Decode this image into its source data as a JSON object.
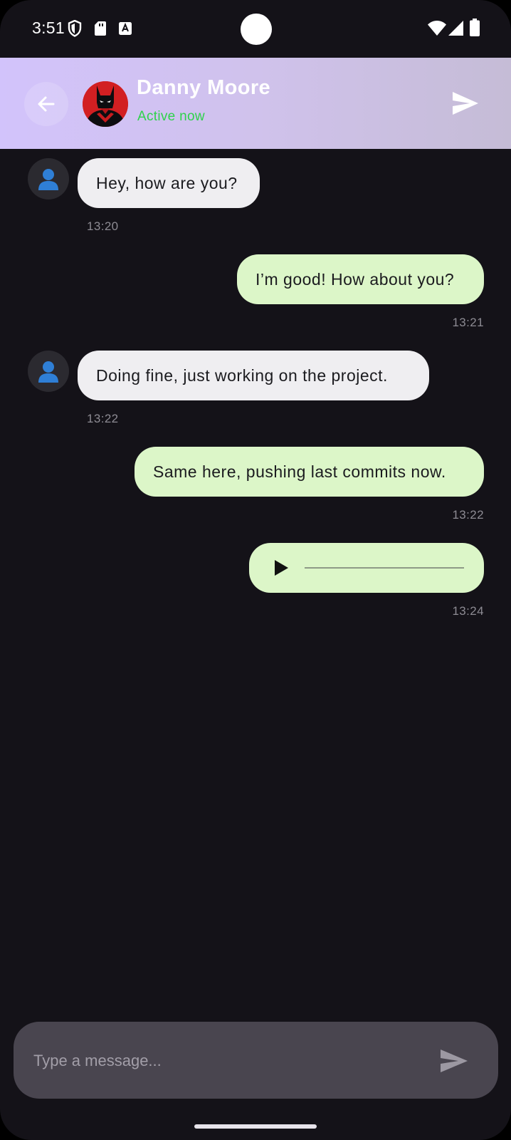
{
  "status_bar": {
    "time": "3:51"
  },
  "header": {
    "contact_name": "Danny Moore",
    "contact_status": "Active now"
  },
  "messages": [
    {
      "direction": "incoming",
      "text": "Hey, how are you?",
      "time": "13:20"
    },
    {
      "direction": "outgoing",
      "text": "I’m good! How about you?",
      "time": "13:21"
    },
    {
      "direction": "incoming",
      "text": "Doing fine, just working on the project.",
      "time": "13:22"
    },
    {
      "direction": "outgoing",
      "text": "Same here, pushing last commits now.",
      "time": "13:22"
    },
    {
      "direction": "outgoing",
      "type": "voice",
      "progress": 0,
      "time": "13:24"
    }
  ],
  "composer": {
    "placeholder": "Type a message..."
  },
  "colors": {
    "background": "#141218",
    "incoming_bubble": "#efeef1",
    "outgoing_bubble": "#dcf6c8",
    "active_status": "#2fd24b",
    "header_gradient_start": "#d2c3fb",
    "header_gradient_end": "#c5bcd6"
  },
  "icons": {
    "back": "arrow-left-icon",
    "send": "send-icon",
    "avatar_placeholder": "user-silhouette-icon",
    "play": "play-icon"
  }
}
